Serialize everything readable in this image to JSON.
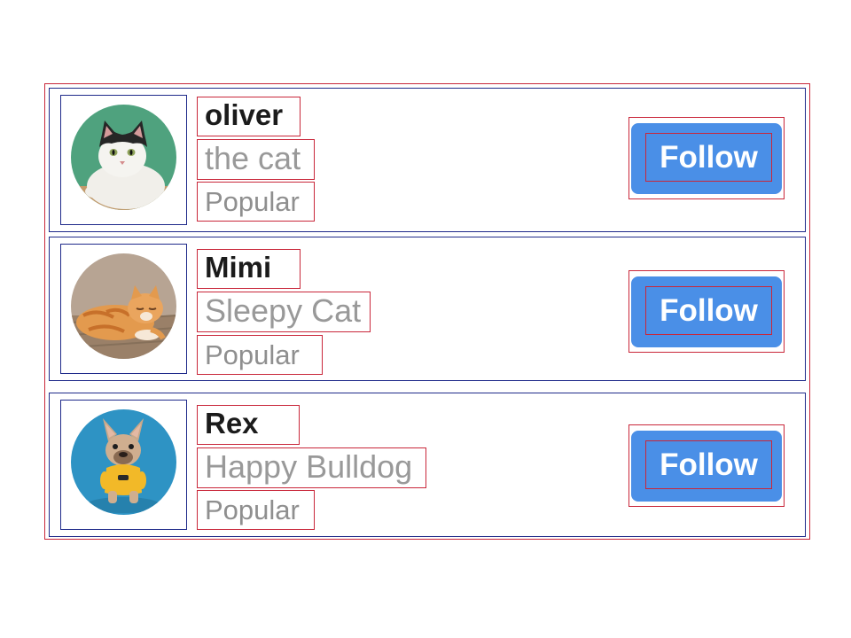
{
  "profiles": [
    {
      "name": "oliver",
      "subtitle": "the cat",
      "tag": "Popular",
      "follow_label": "Follow",
      "avatar_icon": "cat-icon",
      "avatar_bg": "#4fa27e"
    },
    {
      "name": "Mimi",
      "subtitle": "Sleepy Cat",
      "tag": "Popular",
      "follow_label": "Follow",
      "avatar_icon": "cat-icon",
      "avatar_bg": "#b7a493"
    },
    {
      "name": "Rex",
      "subtitle": "Happy Bulldog",
      "tag": "Popular",
      "follow_label": "Follow",
      "avatar_icon": "dog-icon",
      "avatar_bg": "#2e93c4"
    }
  ],
  "colors": {
    "follow_button": "#4a8fe7",
    "name_text": "#1b1b1b",
    "secondary_text": "#999999"
  }
}
